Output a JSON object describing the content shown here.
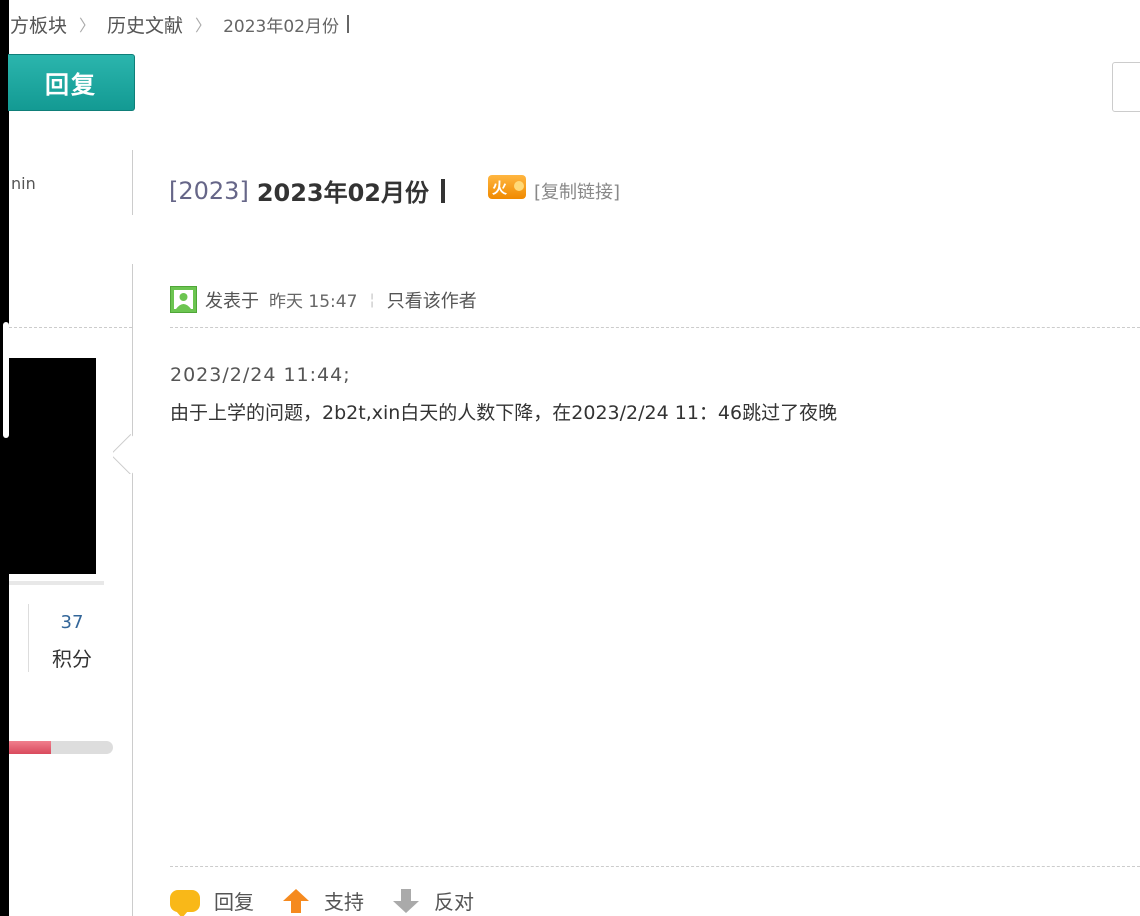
{
  "breadcrumb": {
    "items": [
      "方板块",
      "历史文献",
      "2023年02月份"
    ],
    "separator": "〉"
  },
  "toolbar": {
    "reply_label": "回复"
  },
  "author": {
    "name_partial": "nin"
  },
  "profile": {
    "stat_value": "37",
    "stat_label": "积分",
    "progress_fraction": 0.4
  },
  "thread": {
    "category": "[2023]",
    "title": "2023年02月份",
    "hot_label": "火",
    "copy_link_label": "[复制链接]"
  },
  "post": {
    "posted_label": "发表于",
    "time": "昨天 15:47",
    "only_author_label": "只看该作者",
    "body_line1": "2023/2/24 11:44;",
    "body_line2": "由于上学的问题，2b2t,xin白天的人数下降，在2023/2/24 11：46跳过了夜晚"
  },
  "actions": {
    "reply": "回复",
    "support": "支持",
    "oppose": "反对"
  },
  "colors": {
    "accent": "#1aa59e",
    "hot": "#f39800",
    "user_icon": "#6cc551",
    "progress": "#e05a6b"
  },
  "icons": {
    "user": "user-icon",
    "reply": "speech-bubble-icon",
    "support": "arrow-up-icon",
    "oppose": "arrow-down-icon",
    "hot": "hot-icon"
  }
}
